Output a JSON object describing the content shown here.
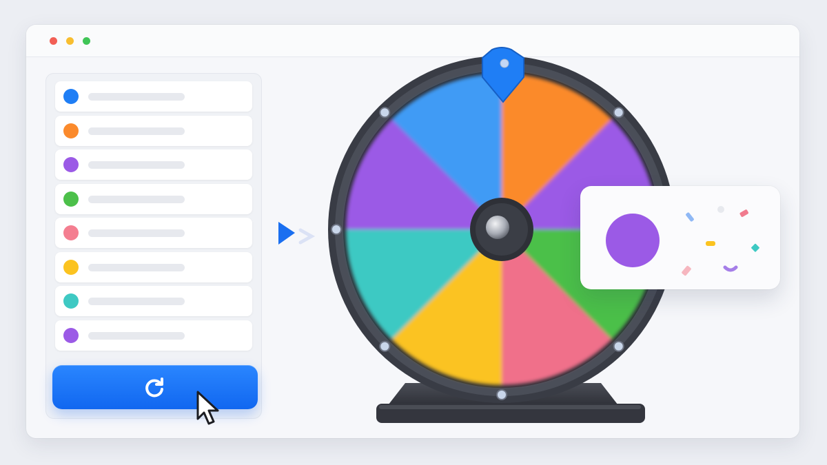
{
  "window": {
    "controls": [
      {
        "name": "close",
        "color": "#f25f55"
      },
      {
        "name": "minimize",
        "color": "#f8be30"
      },
      {
        "name": "maximize",
        "color": "#40c557"
      }
    ]
  },
  "entries": [
    {
      "color": "#1f7ef5"
    },
    {
      "color": "#fb8a2c"
    },
    {
      "color": "#9b5ae6"
    },
    {
      "color": "#4cc04a"
    },
    {
      "color": "#f47e90"
    },
    {
      "color": "#fbc320"
    },
    {
      "color": "#3ec9c3"
    },
    {
      "color": "#9b5ae6"
    }
  ],
  "spin_button": {
    "icon": "refresh-icon",
    "color": "#1a73f8"
  },
  "wheel": {
    "segments": [
      {
        "color": "#3f9bf5"
      },
      {
        "color": "#fb8a2c"
      },
      {
        "color": "#9b5ae6"
      },
      {
        "color": "#4cc04a"
      },
      {
        "color": "#f0708a"
      },
      {
        "color": "#fbc320"
      },
      {
        "color": "#3ec9c3"
      },
      {
        "color": "#9b5ae6"
      }
    ],
    "pointer_color": "#1f7ef5",
    "rim_color": "#3d4049"
  },
  "result": {
    "color": "#9b5ae6",
    "icon": "confetti-icon"
  }
}
